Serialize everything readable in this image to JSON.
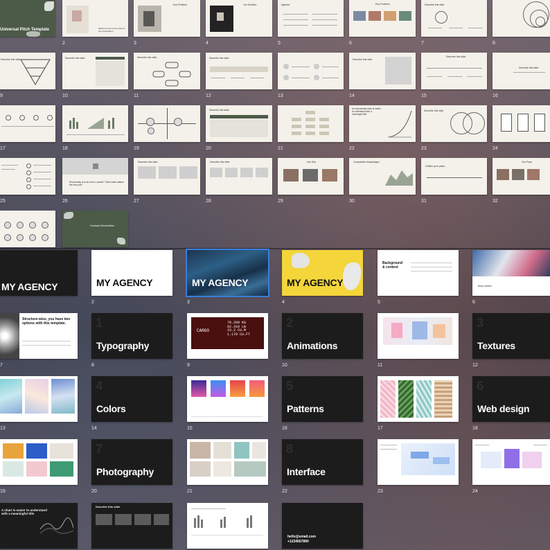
{
  "deck_a": {
    "title_slide": "Universal Pitch Template",
    "slide2_text": "Welcome and on the area for the presentation",
    "slide3_title": "Your Problem",
    "slide4_title": "Our Solution",
    "slide5_title": "Agenda",
    "slide6_title": "Key Features",
    "describe": "Describe this slide",
    "describe_table": "Describe this table",
    "slide22_title": "An exponential chart is easier to understand with a meaningful title",
    "slide26_text": "Real beauty is to be true to oneself. That's what matters the first point.",
    "slide29_title": "Info Slot",
    "slide30_title": "Competitive Advantages",
    "slide31_title": "Outline your plans",
    "slide32_title": "Our Team",
    "slide34_text": "Contact Information",
    "nums": [
      "2",
      "3",
      "4",
      "5",
      "6",
      "7",
      "8",
      "9",
      "10",
      "11",
      "12",
      "13",
      "14",
      "15",
      "16",
      "17",
      "18",
      "19",
      "20",
      "21",
      "22",
      "23",
      "24",
      "25",
      "26",
      "27",
      "28",
      "29",
      "30",
      "31",
      "32"
    ]
  },
  "deck_b": {
    "agency": "MY AGENCY",
    "slide5_title": "Background & context",
    "slide6_text": "Body section",
    "slide8_title": "Structure-wise, you have two options with this template.",
    "typography": "Typography",
    "animations": "Animations",
    "textures": "Textures",
    "colors": "Colors",
    "patterns": "Patterns",
    "web_design": "Web design",
    "photography": "Photography",
    "interface": "Interface",
    "slide25_title": "A chart is easier to understand with a meaningful title",
    "slide26_title": "Describe this slide",
    "email": "hello@email.com",
    "phone": "+1234567890",
    "ghost": [
      "1",
      "2",
      "3",
      "4",
      "5",
      "6",
      "7",
      "8"
    ],
    "cargo_lines": [
      "CARGO",
      "78.260 KG",
      "62.310 LB",
      "33.2 CU.M",
      "1.170 CU.FT"
    ],
    "nums": [
      "2",
      "3",
      "4",
      "5",
      "6",
      "7",
      "8",
      "9",
      "10",
      "11",
      "12",
      "13",
      "14",
      "15",
      "16",
      "17",
      "18",
      "19",
      "20",
      "21",
      "22",
      "23",
      "24"
    ]
  }
}
